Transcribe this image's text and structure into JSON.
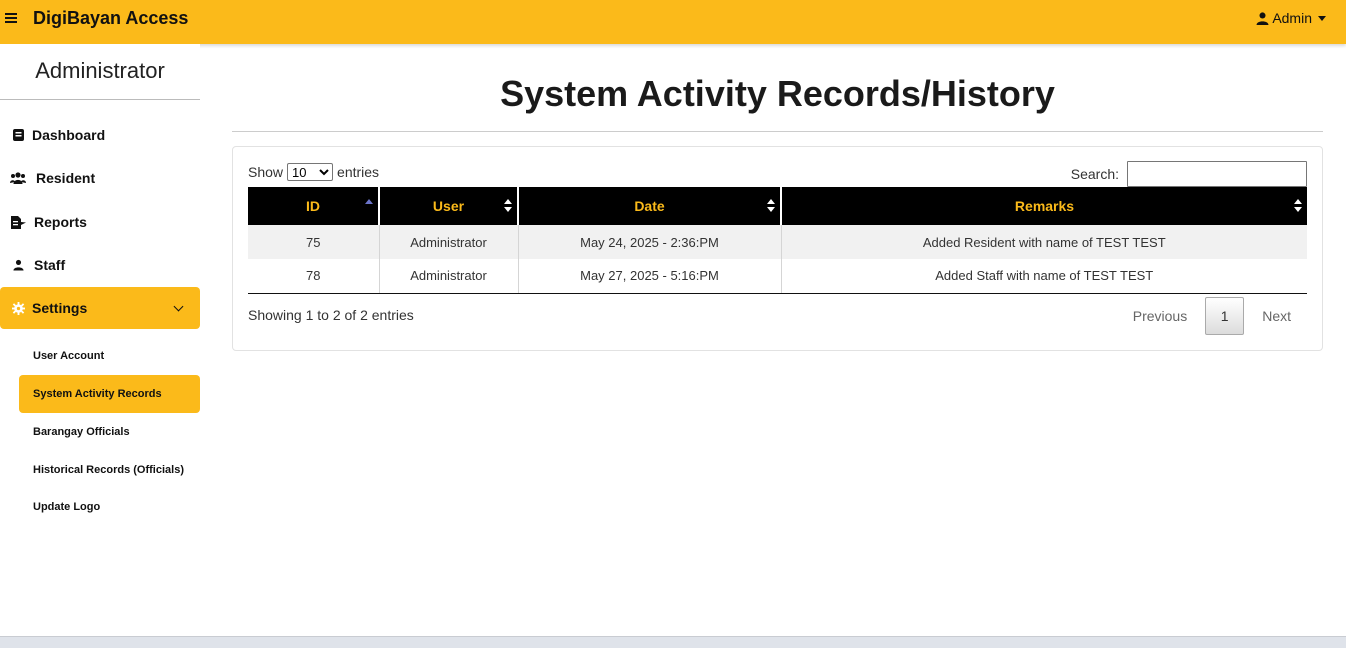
{
  "header": {
    "brand": "DigiBayan Access",
    "user_menu_label": "Admin"
  },
  "sidebar": {
    "title": "Administrator",
    "items": [
      {
        "label": "Dashboard",
        "icon": "dashboard-icon"
      },
      {
        "label": "Resident",
        "icon": "users-icon"
      },
      {
        "label": "Reports",
        "icon": "report-file-icon"
      },
      {
        "label": "Staff",
        "icon": "user-icon"
      },
      {
        "label": "Settings",
        "icon": "gear-icon"
      }
    ],
    "settings_subitems": [
      {
        "label": "User Account"
      },
      {
        "label": "System Activity Records"
      },
      {
        "label": "Barangay Officials"
      },
      {
        "label": "Historical Records (Officials)"
      },
      {
        "label": "Update Logo"
      }
    ]
  },
  "main": {
    "title": "System Activity Records/History",
    "length": {
      "show_label": "Show",
      "selected": "10",
      "entries_label": "entries"
    },
    "search": {
      "label": "Search:",
      "value": ""
    },
    "table": {
      "columns": [
        "ID",
        "User",
        "Date",
        "Remarks"
      ],
      "sorted_column": "ID",
      "sort_direction": "asc",
      "rows": [
        [
          "75",
          "Administrator",
          "May 24, 2025 - 2:36:PM",
          "Added Resident with name of TEST TEST"
        ],
        [
          "78",
          "Administrator",
          "May 27, 2025 - 5:16:PM",
          "Added Staff with name of TEST TEST"
        ]
      ]
    },
    "info": "Showing 1 to 2 of 2 entries",
    "pagination": {
      "previous": "Previous",
      "current_page": "1",
      "next": "Next"
    }
  },
  "colors": {
    "accent": "#fbba1a",
    "table_header_bg": "#000000",
    "sort_active": "#6b74c9"
  }
}
